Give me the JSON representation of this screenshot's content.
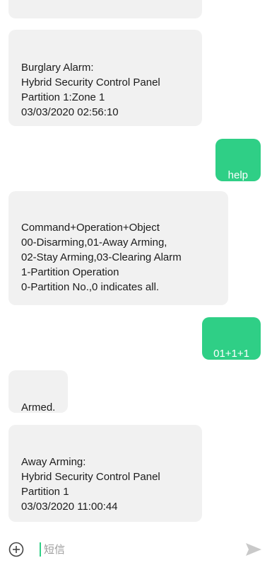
{
  "messages": [
    {
      "id": "m0",
      "direction": "incoming",
      "text": ""
    },
    {
      "id": "m1",
      "direction": "incoming",
      "text": "Burglary Alarm:\nHybrid Security Control Panel\nPartition 1:Zone 1\n03/03/2020 02:56:10"
    },
    {
      "id": "m2",
      "direction": "outgoing",
      "text": "help"
    },
    {
      "id": "m3",
      "direction": "incoming",
      "text": "Command+Operation+Object\n00-Disarming,01-Away Arming,\n02-Stay Arming,03-Clearing Alarm\n1-Partition Operation\n0-Partition No.,0 indicates all."
    },
    {
      "id": "m4",
      "direction": "outgoing",
      "text": "01+1+1"
    },
    {
      "id": "m5",
      "direction": "incoming",
      "text": "Armed."
    },
    {
      "id": "m6",
      "direction": "incoming",
      "text": "Away Arming:\nHybrid Security Control Panel\nPartition 1\n03/03/2020 11:00:44"
    }
  ],
  "composer": {
    "placeholder": "短信",
    "value": "",
    "add_icon": "plus-circle-icon",
    "send_icon": "send-icon"
  },
  "colors": {
    "incoming_bubble": "#f1f1f1",
    "outgoing_bubble": "#2fcf86",
    "send_icon": "#c9c9c9"
  }
}
